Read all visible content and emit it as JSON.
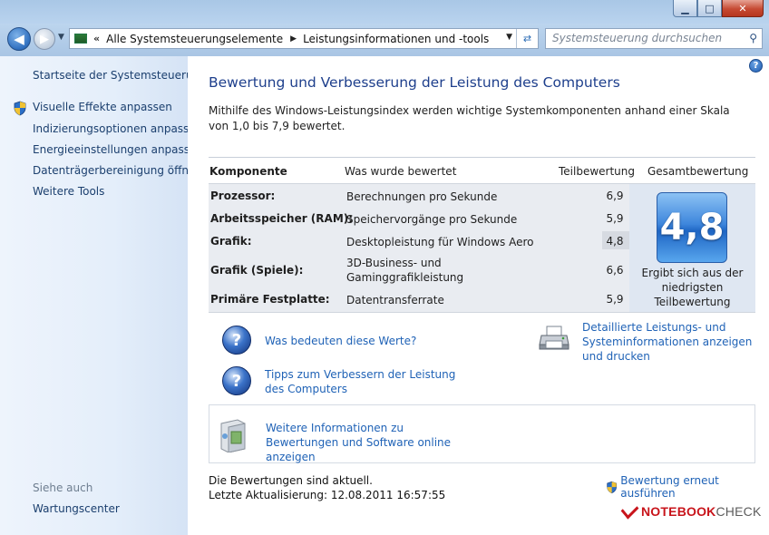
{
  "window": {
    "buttons": {
      "minimize": "▁",
      "maximize": "□",
      "close": "✕"
    }
  },
  "navbar": {
    "breadcrumb": [
      "Alle Systemsteuerungselemente",
      "Leistungsinformationen und -tools"
    ],
    "search_placeholder": "Systemsteuerung durchsuchen"
  },
  "sidebar": {
    "home_link": "Startseite der Systemsteuerung",
    "items": [
      {
        "label": "Visuelle Effekte anpassen",
        "icon": "uac-shield-icon"
      },
      {
        "label": "Indizierungsoptionen anpassen"
      },
      {
        "label": "Energieeinstellungen anpassen"
      },
      {
        "label": "Datenträgerbereinigung öffnen"
      },
      {
        "label": "Weitere Tools"
      }
    ],
    "see_also_heading": "Siehe auch",
    "see_also_items": [
      "Wartungscenter"
    ]
  },
  "main": {
    "title": "Bewertung und Verbesserung der Leistung des Computers",
    "description": "Mithilfe des Windows-Leistungsindex werden wichtige Systemkomponenten anhand einer Skala von 1,0 bis 7,9 bewertet.",
    "table": {
      "headers": {
        "component": "Komponente",
        "rated": "Was wurde bewertet",
        "subscore": "Teilbewertung",
        "basescore": "Gesamtbewertung"
      },
      "rows": [
        {
          "component": "Prozessor:",
          "rated": "Berechnungen pro Sekunde",
          "subscore": "6,9"
        },
        {
          "component": "Arbeitsspeicher (RAM):",
          "rated": "Speichervorgänge pro Sekunde",
          "subscore": "5,9"
        },
        {
          "component": "Grafik:",
          "rated": "Desktopleistung für Windows Aero",
          "subscore": "4,8"
        },
        {
          "component": "Grafik (Spiele):",
          "rated": "3D-Business- und\nGaminggrafikleistung",
          "subscore": "6,6"
        },
        {
          "component": "Primäre Festplatte:",
          "rated": "Datentransferrate",
          "subscore": "5,9"
        }
      ],
      "base_score": "4,8",
      "base_caption": "Ergibt sich aus der niedrigsten Teilbewertung"
    },
    "links": {
      "what_mean": "Was bedeuten diese Werte?",
      "tips": "Tipps zum Verbessern der Leistung des Computers",
      "details": "Detaillierte Leistungs- und Systeminformationen anzeigen und drucken",
      "online": "Weitere Informationen zu Bewertungen und Software online anzeigen"
    },
    "status": {
      "current": "Die Bewertungen sind aktuell.",
      "last_update": "Letzte Aktualisierung: 12.08.2011 16:57:55",
      "rerun": "Bewertung erneut ausführen"
    }
  },
  "watermark": {
    "part1": "NOTEBOOK",
    "part2": "CHECK"
  }
}
